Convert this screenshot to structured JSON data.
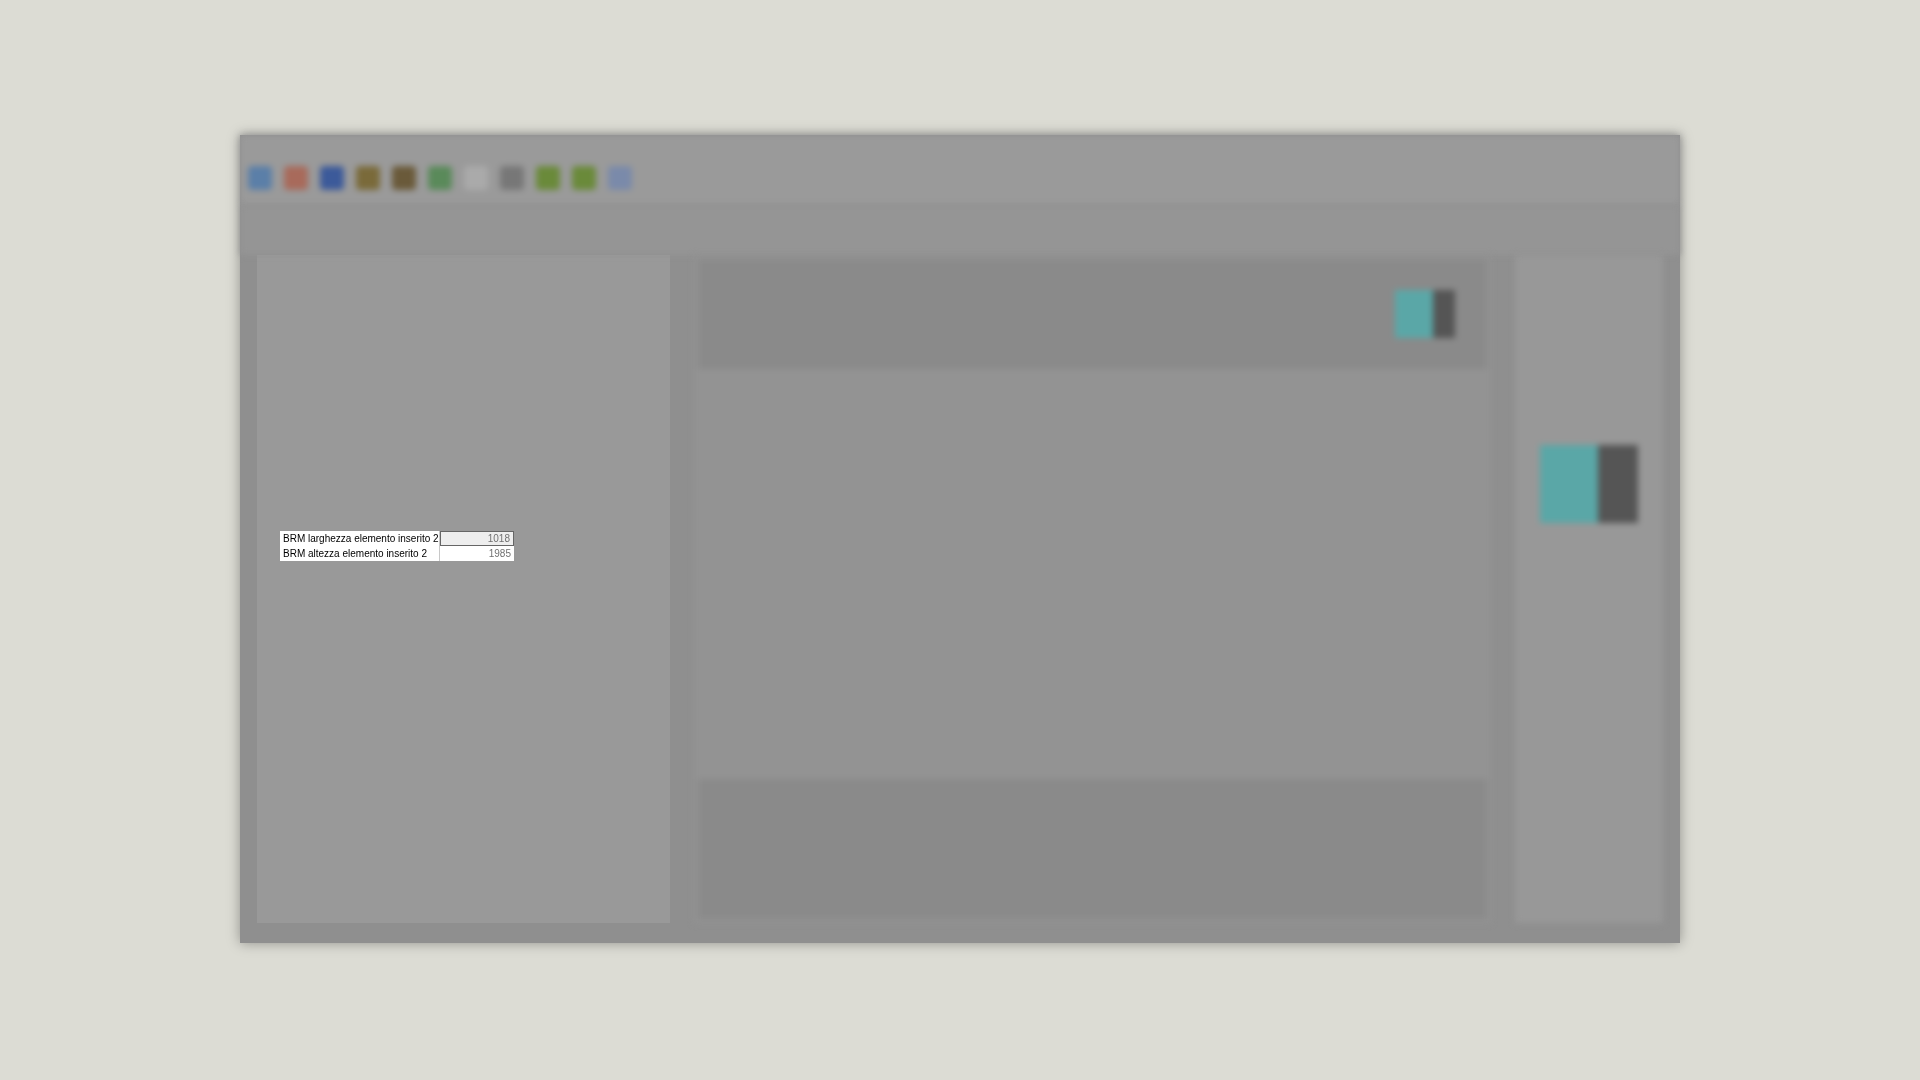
{
  "attribute_rows": [
    {
      "label": "BRM larghezza elemento inserito 2",
      "value": "1018",
      "selected": true
    },
    {
      "label": "BRM altezza elemento inserito 2",
      "value": "1985",
      "selected": false
    }
  ]
}
